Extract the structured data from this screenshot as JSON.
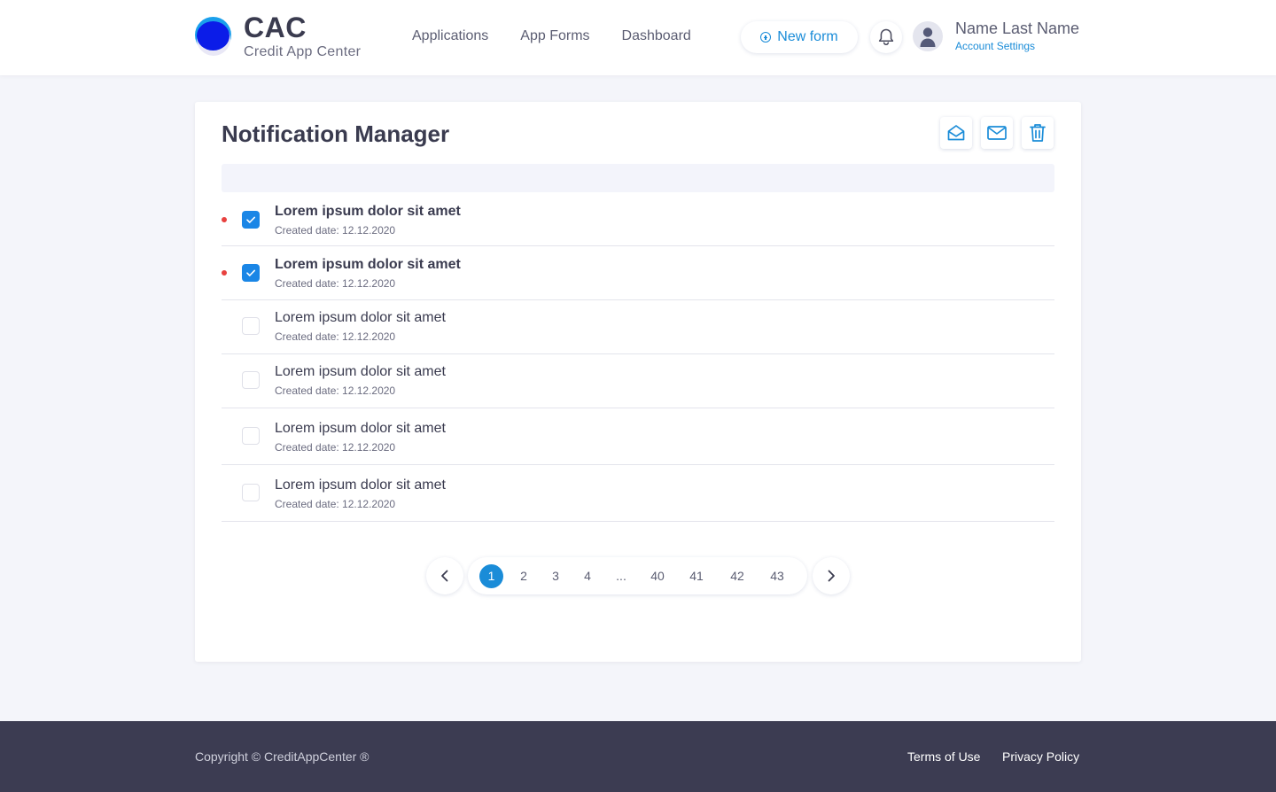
{
  "header": {
    "logo_title": "CAC",
    "logo_subtitle": "Credit App Center",
    "nav": [
      "Applications",
      "App Forms",
      "Dashboard"
    ],
    "new_form_label": "New form",
    "user_name": "Name Last Name",
    "account_settings": "Account Settings"
  },
  "card": {
    "title": "Notification Manager",
    "toolbar_icons": [
      "mail-open-icon",
      "mail-icon",
      "trash-icon"
    ]
  },
  "notifications": [
    {
      "title": "Lorem ipsum dolor sit amet",
      "date": "Created date: 12.12.2020",
      "unread": true,
      "checked": true
    },
    {
      "title": "Lorem ipsum dolor sit amet",
      "date": "Created date: 12.12.2020",
      "unread": true,
      "checked": true
    },
    {
      "title": "Lorem ipsum dolor sit amet",
      "date": "Created date: 12.12.2020",
      "unread": false,
      "checked": false
    },
    {
      "title": "Lorem ipsum dolor sit amet",
      "date": "Created date: 12.12.2020",
      "unread": false,
      "checked": false
    },
    {
      "title": "Lorem ipsum dolor sit amet",
      "date": "Created date: 12.12.2020",
      "unread": false,
      "checked": false
    },
    {
      "title": "Lorem ipsum dolor sit amet",
      "date": "Created date: 12.12.2020",
      "unread": false,
      "checked": false
    }
  ],
  "pagination": {
    "active": "1",
    "pages": [
      "2",
      "3",
      "4",
      "...",
      "40",
      "41",
      "42",
      "43"
    ]
  },
  "footer": {
    "copyright": "Copyright © CreditAppCenter ®",
    "terms": "Terms of Use",
    "privacy": "Privacy Policy"
  },
  "colors": {
    "accent": "#1a8cd8",
    "checkbox": "#1a86e6",
    "unread_dot": "#e8413f",
    "footer_bg": "#3c3c52"
  }
}
